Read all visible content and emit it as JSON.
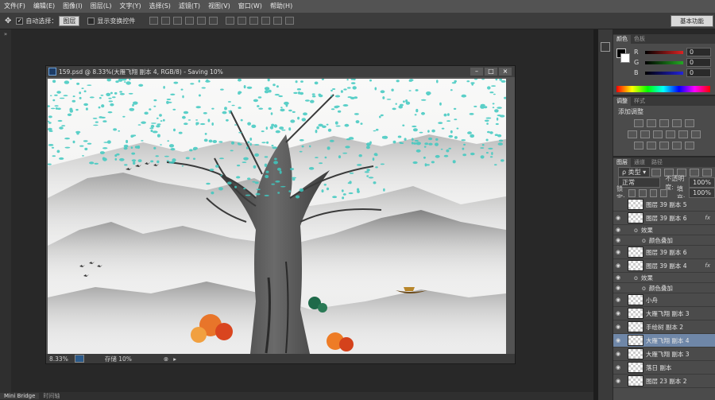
{
  "menu": [
    "文件(F)",
    "编辑(E)",
    "图像(I)",
    "图层(L)",
    "文字(Y)",
    "选择(S)",
    "滤镜(T)",
    "视图(V)",
    "窗口(W)",
    "帮助(H)"
  ],
  "options": {
    "auto_select_label": "自动选择：",
    "auto_select_value": "图层",
    "show_transform_label": "显示变换控件"
  },
  "workspace": "基本功能",
  "document": {
    "title": "159.psd @ 8.33%(大雁飞翔 副本 4, RGB/8) - Saving 10%",
    "zoom": "8.33%",
    "status": "存储 10%"
  },
  "color_panel": {
    "tabs": [
      "颜色",
      "色板"
    ],
    "channels": [
      {
        "label": "R",
        "value": "0"
      },
      {
        "label": "G",
        "value": "0"
      },
      {
        "label": "B",
        "value": "0"
      }
    ]
  },
  "adjust_panel": {
    "tabs": [
      "调整",
      "样式"
    ],
    "title": "添加调整"
  },
  "layers_panel": {
    "tabs": [
      "图层",
      "通道",
      "路径"
    ],
    "kind": "类型",
    "blend_mode": "正常",
    "opacity_label": "不透明度:",
    "opacity": "100%",
    "lock_label": "锁定:",
    "fill_label": "填充:",
    "fill": "100%",
    "layers": [
      {
        "name": "图层 39 副本 5",
        "visible": false,
        "fx": false,
        "type": "layer"
      },
      {
        "name": "图层 39 副本 6",
        "visible": true,
        "fx": true,
        "type": "layer"
      },
      {
        "name": "效果",
        "visible": true,
        "fx": false,
        "type": "sub"
      },
      {
        "name": "颜色叠加",
        "visible": true,
        "fx": false,
        "type": "sub2"
      },
      {
        "name": "图层 39 副本 6",
        "visible": true,
        "fx": false,
        "type": "layer"
      },
      {
        "name": "图层 39 副本 4",
        "visible": true,
        "fx": true,
        "type": "layer"
      },
      {
        "name": "效果",
        "visible": true,
        "fx": false,
        "type": "sub"
      },
      {
        "name": "颜色叠加",
        "visible": true,
        "fx": false,
        "type": "sub2"
      },
      {
        "name": "小舟",
        "visible": true,
        "fx": false,
        "type": "layer"
      },
      {
        "name": "大雁飞翔 副本 3",
        "visible": true,
        "fx": false,
        "type": "layer"
      },
      {
        "name": "手绘树 副本 2",
        "visible": true,
        "fx": false,
        "type": "layer"
      },
      {
        "name": "大雁飞翔 副本 4",
        "visible": true,
        "fx": false,
        "type": "layer",
        "selected": true
      },
      {
        "name": "大雁飞翔 副本 3",
        "visible": true,
        "fx": false,
        "type": "layer"
      },
      {
        "name": "落日 副本",
        "visible": true,
        "fx": false,
        "type": "layer"
      },
      {
        "name": "图层 23 副本 2",
        "visible": true,
        "fx": false,
        "type": "layer"
      }
    ]
  },
  "bottom_tabs": [
    "Mini Bridge",
    "时间轴"
  ],
  "colors": {
    "menubar": "#535353",
    "panel": "#4b4b4b",
    "selected_layer": "#6f87a8",
    "teal_leaves": "#3fc9c0"
  }
}
